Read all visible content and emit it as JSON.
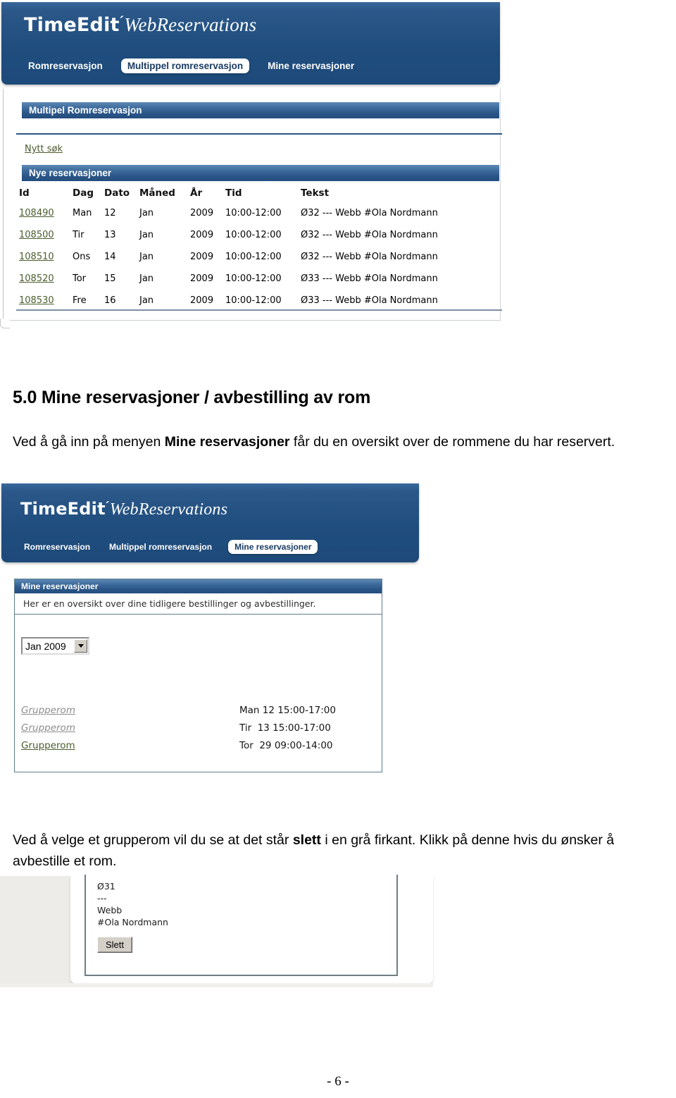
{
  "app": {
    "brand": "TimeEdit",
    "brand_mark": "´",
    "product": "WebReservations",
    "nav": [
      {
        "label": "Romreservasjon",
        "active": false
      },
      {
        "label": "Multippel romreservasjon",
        "active": true
      },
      {
        "label": "Mine reservasjoner",
        "active": false
      }
    ],
    "nav2": [
      {
        "label": "Romreservasjon",
        "active": false
      },
      {
        "label": "Multippel romreservasjon",
        "active": false
      },
      {
        "label": "Mine reservasjoner",
        "active": true
      }
    ]
  },
  "shot1": {
    "panel_title": "Multipel Romreservasjon",
    "new_search_link": "Nytt søk",
    "section_title": "Nye reservasjoner",
    "columns": [
      "Id",
      "Dag",
      "Dato",
      "Måned",
      "År",
      "Tid",
      "Tekst"
    ],
    "rows": [
      {
        "id": "108490",
        "dag": "Man",
        "dato": "12",
        "maned": "Jan",
        "ar": "2009",
        "tid": "10:00-12:00",
        "tekst": "Ø32 --- Webb #Ola Nordmann"
      },
      {
        "id": "108500",
        "dag": "Tir",
        "dato": "13",
        "maned": "Jan",
        "ar": "2009",
        "tid": "10:00-12:00",
        "tekst": "Ø32 --- Webb #Ola Nordmann"
      },
      {
        "id": "108510",
        "dag": "Ons",
        "dato": "14",
        "maned": "Jan",
        "ar": "2009",
        "tid": "10:00-12:00",
        "tekst": "Ø32 --- Webb #Ola Nordmann"
      },
      {
        "id": "108520",
        "dag": "Tor",
        "dato": "15",
        "maned": "Jan",
        "ar": "2009",
        "tid": "10:00-12:00",
        "tekst": "Ø33 --- Webb #Ola Nordmann"
      },
      {
        "id": "108530",
        "dag": "Fre",
        "dato": "16",
        "maned": "Jan",
        "ar": "2009",
        "tid": "10:00-12:00",
        "tekst": "Ø33 --- Webb #Ola Nordmann"
      }
    ]
  },
  "section": {
    "heading": "5.0 Mine reservasjoner / avbestilling av rom",
    "para1_a": "Ved å gå inn på menyen ",
    "para1_bold": "Mine reservasjoner",
    "para1_b": " får du en oversikt over de rommene du har reservert.",
    "para2_a": "Ved å velge et grupperom vil du se at det står ",
    "para2_bold": "slett",
    "para2_b": " i en grå firkant. Klikk på denne hvis du ønsker å avbestille et rom."
  },
  "shot2": {
    "panel_title": "Mine reservasjoner",
    "description": "Her er en oversikt over dine tidligere bestillinger og avbestillinger.",
    "month_select": {
      "value": "Jan 2009",
      "options": [
        "Jan 2009"
      ]
    },
    "rows": [
      {
        "name": "Grupperom",
        "time": "Man 12 15:00-17:00",
        "cancelled": true
      },
      {
        "name": "Grupperom",
        "time": "Tir  13 15:00-17:00",
        "cancelled": true
      },
      {
        "name": "Grupperom",
        "time": "Tor  29 09:00-14:00",
        "cancelled": false
      }
    ]
  },
  "shot3": {
    "detail_lines": [
      "Ø31",
      "---",
      "Webb",
      "#Ola Nordmann"
    ],
    "delete_button": "Slett"
  },
  "footer": {
    "page_number": "- 6 -"
  },
  "colors": {
    "header_blue": "#1f4d7e",
    "panel_blue": "#2a5587",
    "link_green": "#4a5d2e",
    "link_gray": "#8d8d8d",
    "button_face": "#d4d0c8"
  }
}
